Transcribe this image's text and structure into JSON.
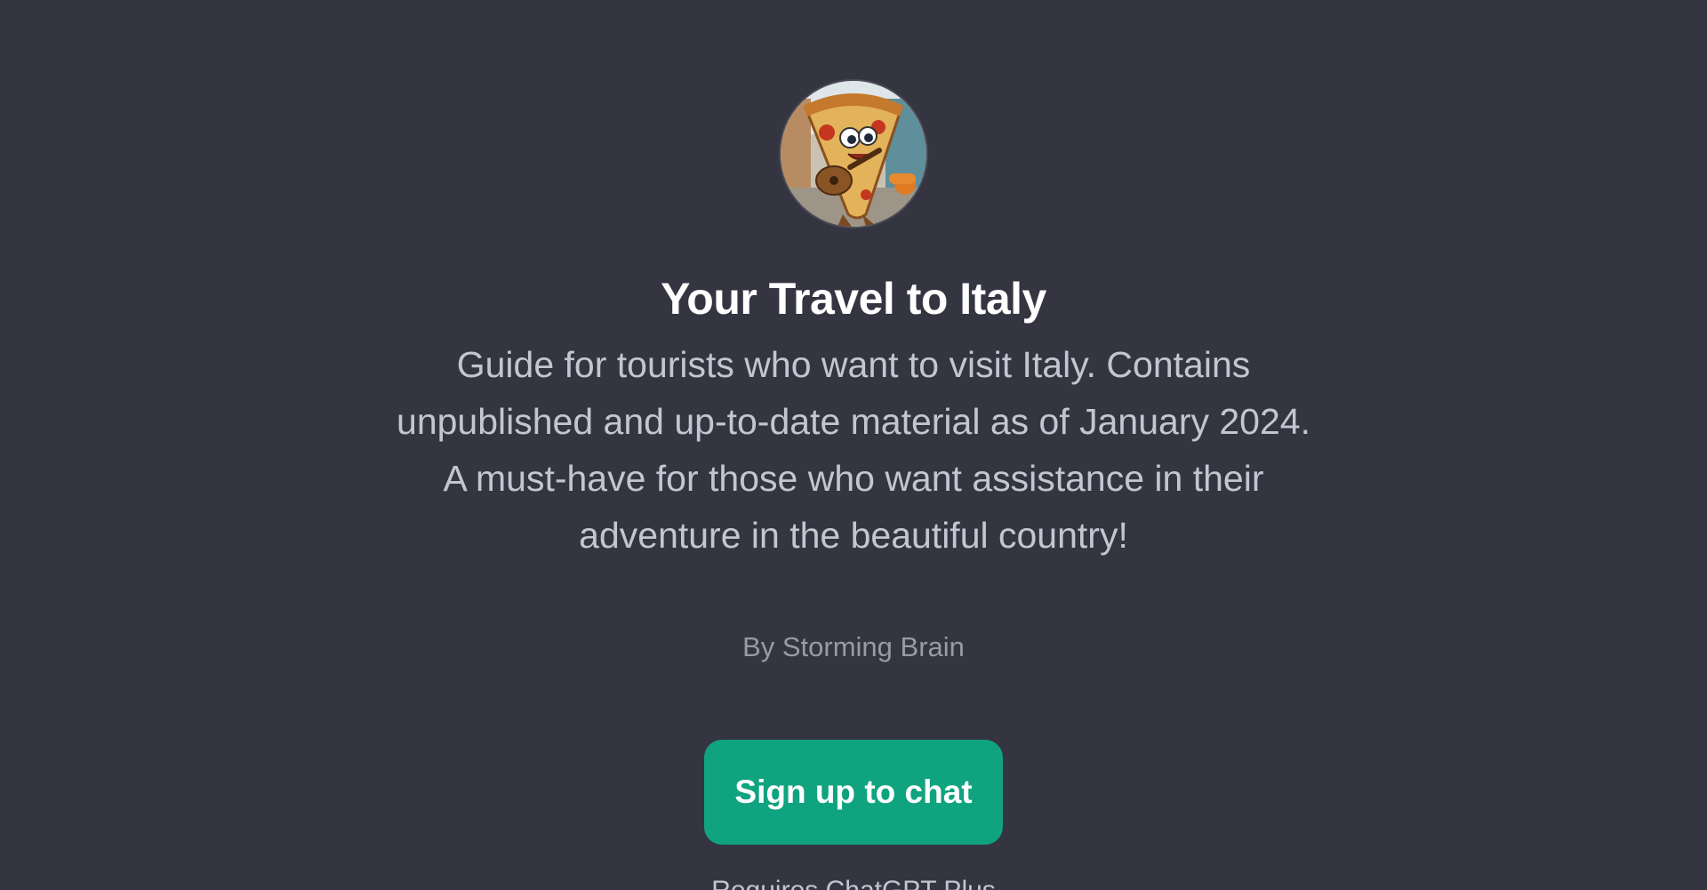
{
  "gpt": {
    "avatar_icon": "pizza-slice-mascot-icon",
    "title": "Your Travel to Italy",
    "description": "Guide for tourists who want to visit Italy. Contains unpublished and up-to-date material as of January 2024. A must-have for those who want assistance in their adventure in the beautiful country!",
    "author": "By Storming Brain"
  },
  "actions": {
    "signup_label": "Sign up to chat"
  },
  "footer": {
    "note": "Requires ChatGPT Plus"
  },
  "colors": {
    "background": "#343541",
    "accent": "#10a37f",
    "title": "#ffffff",
    "description": "#c5c5d2",
    "author": "#9a9aa6"
  }
}
